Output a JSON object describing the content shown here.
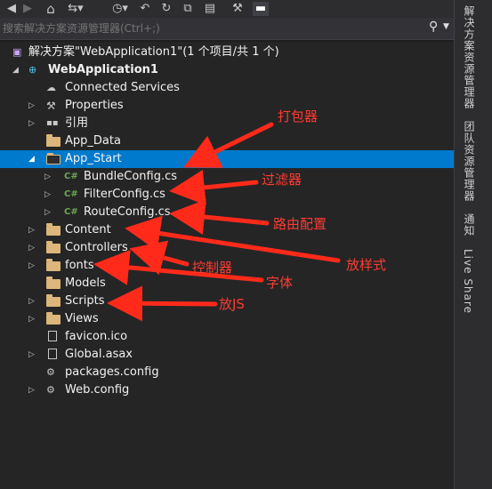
{
  "toolbar": {
    "buttons": [
      {
        "icon": "back-icon",
        "glyph": "◀"
      },
      {
        "icon": "forward-icon",
        "glyph": "▶"
      },
      {
        "icon": "home-icon",
        "glyph": "⌂"
      },
      {
        "icon": "sync-view-icon",
        "glyph": "⇆"
      },
      {
        "icon": "history-icon",
        "glyph": "◷"
      },
      {
        "icon": "undo-icon",
        "glyph": "↶"
      },
      {
        "icon": "refresh-icon",
        "glyph": "↻"
      },
      {
        "icon": "collapse-all-icon",
        "glyph": "⧉"
      },
      {
        "icon": "properties-icon",
        "glyph": "▤"
      },
      {
        "icon": "wrench-icon",
        "glyph": "🔧"
      },
      {
        "icon": "pin-icon",
        "glyph": "▬"
      }
    ]
  },
  "search": {
    "placeholder": "搜索解决方案资源管理器(Ctrl+;)"
  },
  "tree": {
    "solution": "解决方案\"WebApplication1\"(1 个项目/共 1 个)",
    "project": "WebApplication1",
    "items": [
      {
        "label": "Connected Services",
        "icon": "connected-services-icon"
      },
      {
        "label": "Properties",
        "icon": "wrench-icon"
      },
      {
        "label": "引用",
        "icon": "references-icon"
      },
      {
        "label": "App_Data",
        "icon": "folder-icon"
      },
      {
        "label": "App_Start",
        "icon": "folder-icon"
      },
      {
        "label": "BundleConfig.cs",
        "icon": "csharp-file-icon"
      },
      {
        "label": "FilterConfig.cs",
        "icon": "csharp-file-icon"
      },
      {
        "label": "RouteConfig.cs",
        "icon": "csharp-file-icon"
      },
      {
        "label": "Content",
        "icon": "folder-icon"
      },
      {
        "label": "Controllers",
        "icon": "folder-icon"
      },
      {
        "label": "fonts",
        "icon": "folder-icon"
      },
      {
        "label": "Models",
        "icon": "folder-icon"
      },
      {
        "label": "Scripts",
        "icon": "folder-icon"
      },
      {
        "label": "Views",
        "icon": "folder-icon"
      },
      {
        "label": "favicon.ico",
        "icon": "file-icon"
      },
      {
        "label": "Global.asax",
        "icon": "file-icon"
      },
      {
        "label": "packages.config",
        "icon": "config-file-icon"
      },
      {
        "label": "Web.config",
        "icon": "config-file-icon"
      }
    ]
  },
  "sidebar": {
    "tabs": [
      "解决方案资源管理器",
      "团队资源管理器",
      "通知",
      "Live Share"
    ]
  },
  "annotations": {
    "packager": "打包器",
    "filter": "过滤器",
    "route": "路由配置",
    "style": "放样式",
    "controller": "控制器",
    "font": "字体",
    "js": "放JS",
    "color": "#ff2a1a"
  },
  "colors": {
    "selection": "#007acc",
    "folder": "#dcb67a",
    "background": "#252526"
  }
}
